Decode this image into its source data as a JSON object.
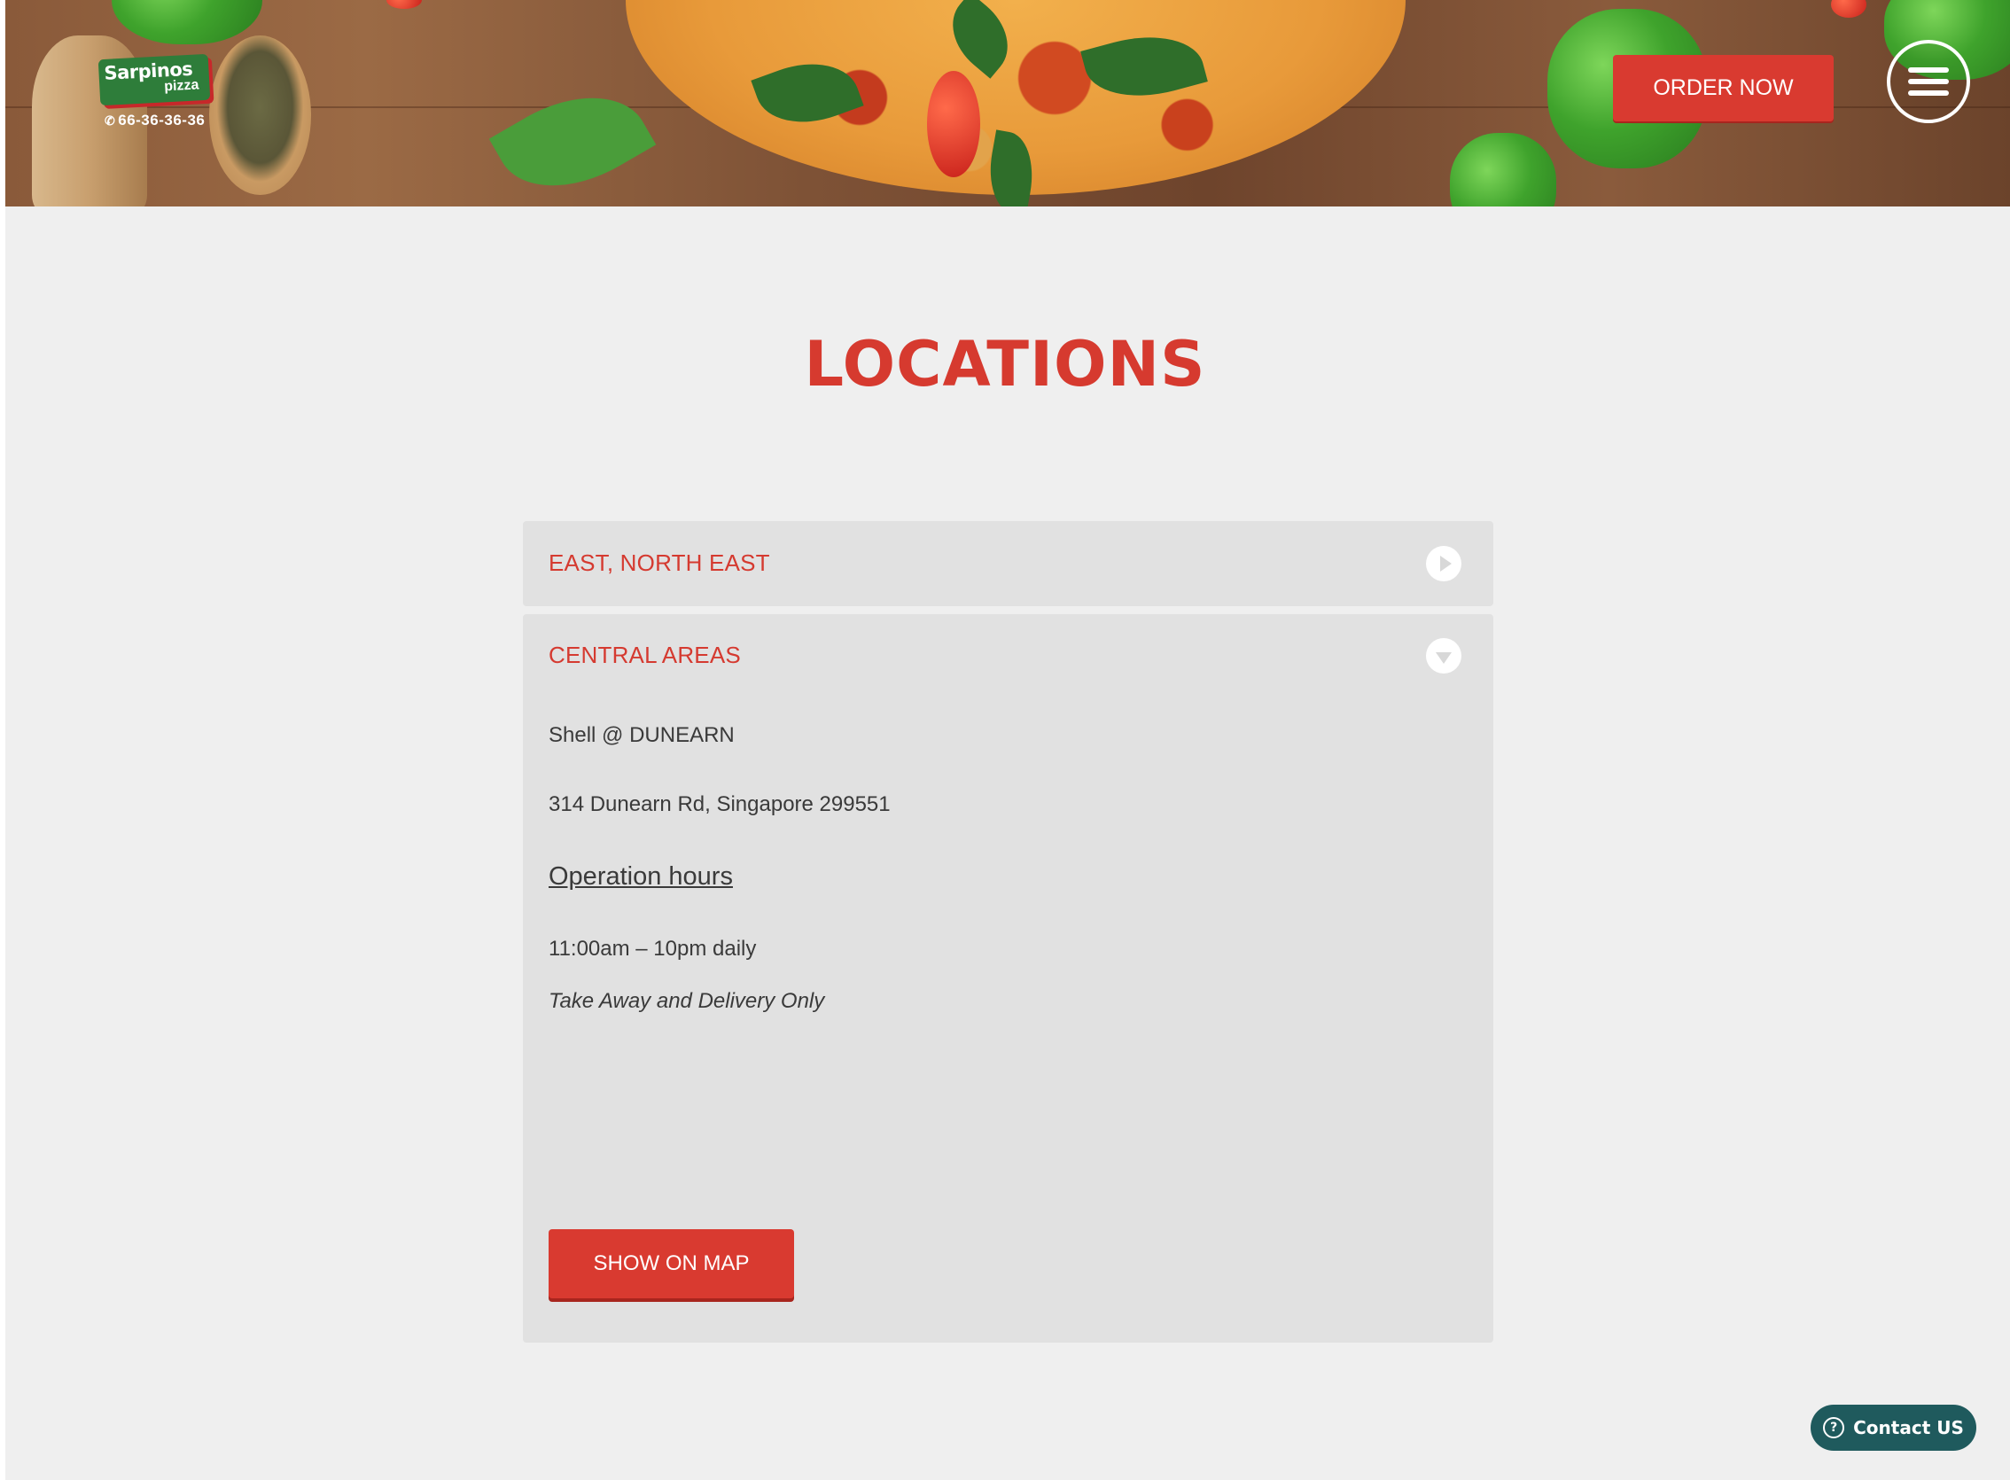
{
  "header": {
    "logo_text": "Sarpinos",
    "logo_subtext": "pizza",
    "phone": "66-36-36-36",
    "order_button": "ORDER NOW",
    "menu_icon": "hamburger-menu-icon"
  },
  "main": {
    "title": "LOCATIONS",
    "accordion": [
      {
        "title": "EAST, NORTH EAST",
        "toggle_icon": "play-right-icon",
        "expanded": false
      },
      {
        "title": "CENTRAL AREAS",
        "toggle_icon": "triangle-down-icon",
        "expanded": true,
        "store_name": "Shell @ DUNEARN",
        "address": "314 Dunearn Rd, Singapore 299551",
        "hours_heading": "Operation hours",
        "hours": "11:00am – 10pm daily",
        "note": "Take Away and Delivery Only",
        "map_button": "SHOW ON MAP"
      }
    ]
  },
  "contact_widget": {
    "label": "Contact US",
    "icon": "help-circle-icon"
  },
  "colors": {
    "accent_red": "#d93a30",
    "title_red": "#d63a2f",
    "page_bg": "#efefef",
    "panel_bg": "#e1e1e1",
    "contact_bg": "#1f5a5d",
    "logo_green": "#2e7d3a"
  }
}
